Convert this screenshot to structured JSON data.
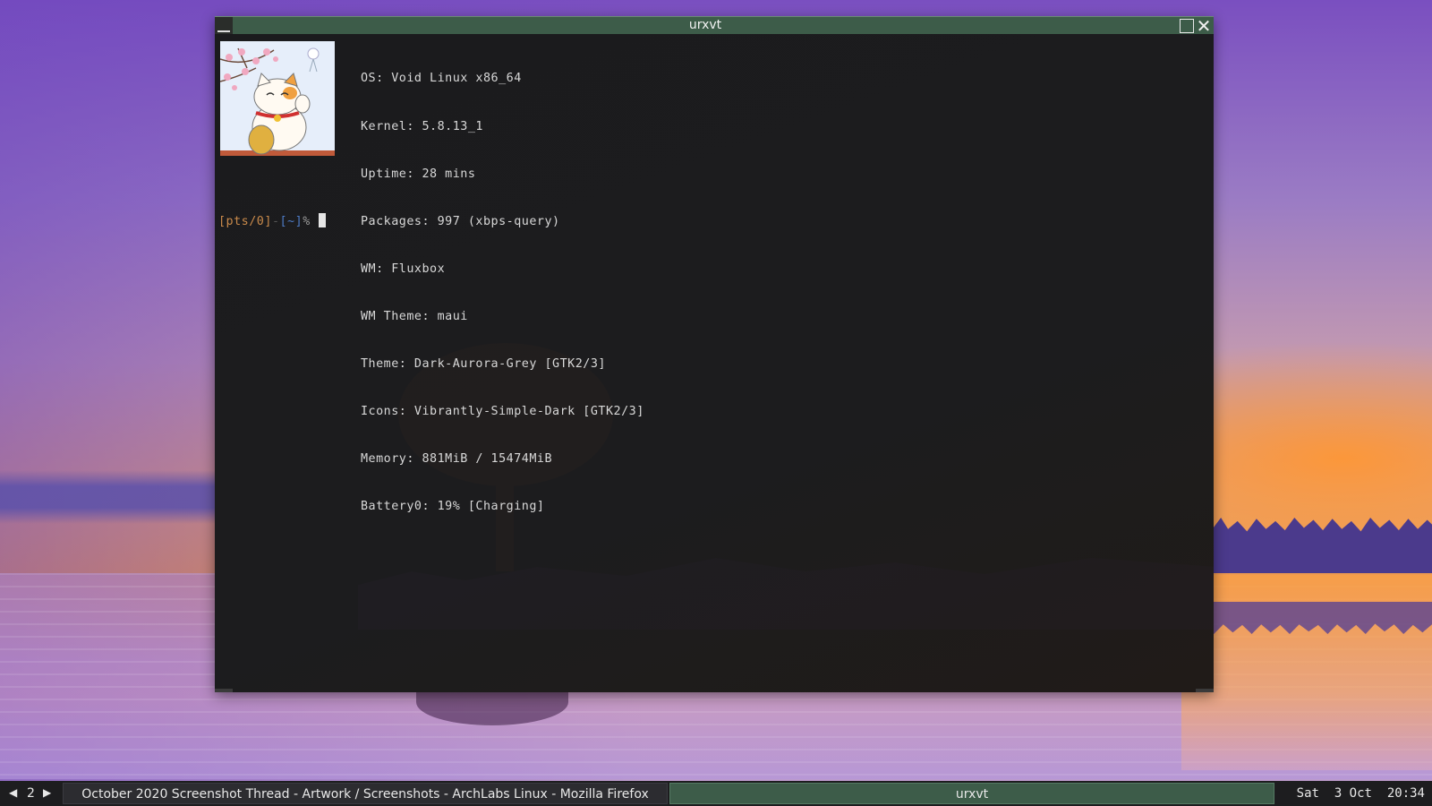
{
  "window": {
    "title": "urxvt",
    "icons": {
      "minimize": "minimize-icon",
      "maximize": "maximize-icon",
      "close": "close-icon"
    }
  },
  "sysinfo": {
    "lines": [
      "OS: Void Linux x86_64",
      "Kernel: 5.8.13_1",
      "Uptime: 28 mins",
      "Packages: 997 (xbps-query)",
      "WM: Fluxbox",
      "WM Theme: maui",
      "Theme: Dark-Aurora-Grey [GTK2/3]",
      "Icons: Vibrantly-Simple-Dark [GTK2/3]",
      "Memory: 881MiB / 15474MiB",
      "Battery0: 19% [Charging]"
    ]
  },
  "prompt": {
    "tty": "[pts/0]",
    "sep": "-",
    "dir": "[~]",
    "symbol": "%"
  },
  "taskbar": {
    "prev_icon": "triangle-left-icon",
    "next_icon": "triangle-right-icon",
    "workspace": "2",
    "tasks": [
      "October 2020 Screenshot Thread - Artwork / Screenshots - ArchLabs Linux - Mozilla Firefox",
      "urxvt"
    ],
    "clock": {
      "day": "Sat",
      "date": "3 Oct",
      "time": "20:34"
    }
  },
  "colors": {
    "titlebar": "#3d5c49",
    "terminal_bg": "#1c1c1e",
    "prompt_tty": "#c98a4b",
    "prompt_dir": "#4d7ac4"
  }
}
